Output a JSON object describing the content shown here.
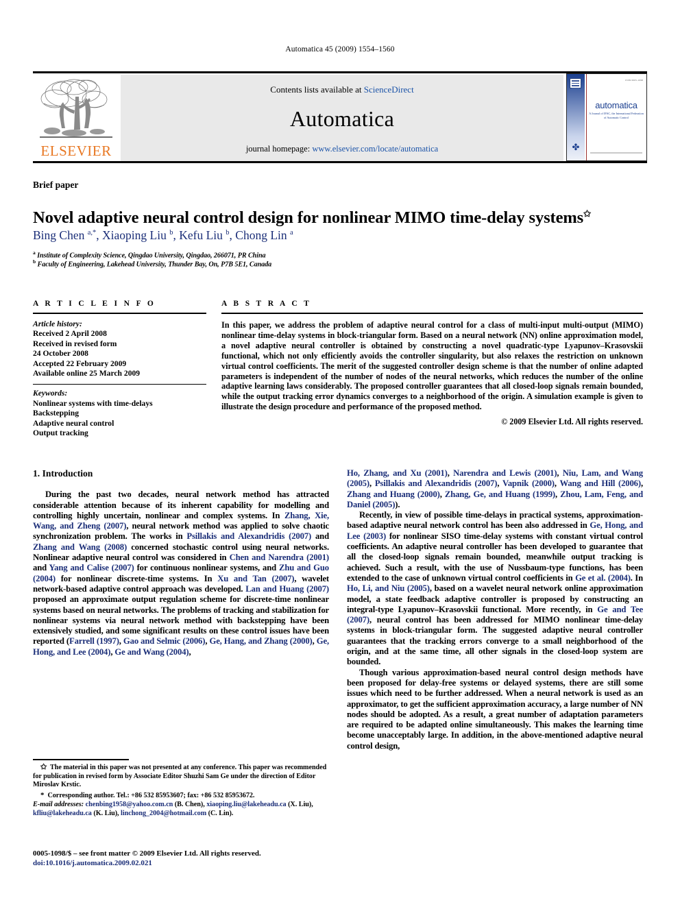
{
  "running_head": "Automatica 45 (2009) 1554–1560",
  "masthead": {
    "contents_prefix": "Contents lists available at ",
    "contents_link": "ScienceDirect",
    "journal_name": "Automatica",
    "homepage_prefix": "journal homepage: ",
    "homepage_link": "www.elsevier.com/locate/automatica",
    "publisher_wordmark": "ELSEVIER",
    "cover": {
      "title": "automatica",
      "subtitle": "A Journal of IFAC, the International Federation of Automatic Control",
      "corner_note": "ISSN 0005-1098"
    }
  },
  "article": {
    "type_label": "Brief paper",
    "title": "Novel adaptive neural control design for nonlinear MIMO time-delay systems",
    "title_star": "✩",
    "authors_html": "Bing Chen <sup>a,</sup><sup>*</sup>, Xiaoping Liu <sup>b</sup>, Kefu Liu <sup>b</sup>, Chong Lin <sup>a</sup>",
    "affiliation_a": "Institute of Complexity Science, Qingdao University, Qingdao, 266071, PR China",
    "affiliation_b": "Faculty of Engineering, Lakehead University, Thunder Bay, On, P7B 5E1, Canada"
  },
  "info": {
    "heading": "A R T I C L E    I N F O",
    "history_label": "Article history:",
    "history": [
      "Received 2 April 2008",
      "Received in revised form",
      "24 October 2008",
      "Accepted 22 February 2009",
      "Available online 25 March 2009"
    ],
    "keywords_label": "Keywords:",
    "keywords": [
      "Nonlinear systems with time-delays",
      "Backstepping",
      "Adaptive neural control",
      "Output tracking"
    ]
  },
  "abstract": {
    "heading": "A B S T R A C T",
    "text": "In this paper, we address the problem of adaptive neural control for a class of multi-input multi-output (MIMO) nonlinear time-delay systems in block-triangular form. Based on a neural network (NN) online approximation model, a novel adaptive neural controller is obtained by constructing a novel quadratic-type Lyapunov–Krasovskii functional, which not only efficiently avoids the controller singularity, but also relaxes the restriction on unknown virtual control coefficients. The merit of the suggested controller design scheme is that the number of online adapted parameters is independent of the number of nodes of the neural networks, which reduces the number of the online adaptive learning laws considerably. The proposed controller guarantees that all closed-loop signals remain bounded, while the output tracking error dynamics converges to a neighborhood of the origin. A simulation example is given to illustrate the design procedure and performance of the proposed method.",
    "copyright": "© 2009 Elsevier Ltd. All rights reserved."
  },
  "body": {
    "section1_heading": "1. Introduction",
    "left_paragraph_1_html": "During the past two decades, neural network method has attracted considerable attention because of its inherent capability for modelling and controlling highly uncertain, nonlinear and complex systems. In <span class=\"ref\">Zhang, Xie, Wang, and Zheng (2007)</span>, neural network method was applied to solve chaotic synchronization problem. The works in <span class=\"ref\">Psillakis and Alexandridis (2007)</span> and <span class=\"ref\">Zhang and Wang (2008)</span> concerned stochastic control using neural networks. Nonlinear adaptive neural control was considered in <span class=\"ref\">Chen and Narendra (2001)</span> and <span class=\"ref\">Yang and Calise (2007)</span> for continuous nonlinear systems, and <span class=\"ref\">Zhu and Guo (2004)</span> for nonlinear discrete-time systems. In <span class=\"ref\">Xu and Tan (2007)</span>, wavelet network-based adaptive control approach was developed. <span class=\"ref\">Lan and Huang (2007)</span> proposed an approximate output regulation scheme for discrete-time nonlinear systems based on neural networks. The problems of tracking and stabilization for nonlinear systems via neural network method with backstepping have been extensively studied, and some significant results on these control issues have been reported (<span class=\"ref\">Farrell (1997)</span>, <span class=\"ref\">Gao and Selmic (2006)</span>, <span class=\"ref\">Ge, Hang, and Zhang (2000)</span>, <span class=\"ref\">Ge, Hong, and Lee (2004)</span>, <span class=\"ref\">Ge and Wang (2004)</span>,",
    "right_paragraph_1_html": "<span class=\"ref\">Ho, Zhang, and Xu (2001)</span>, <span class=\"ref\">Narendra and Lewis (2001)</span>, <span class=\"ref\">Niu, Lam, and Wang (2005)</span>, <span class=\"ref\">Psillakis and Alexandridis (2007)</span>, <span class=\"ref\">Vapnik (2000)</span>, <span class=\"ref\">Wang and Hill (2006)</span>, <span class=\"ref\">Zhang and Huang (2000)</span>, <span class=\"ref\">Zhang, Ge, and Huang (1999)</span>, <span class=\"ref\">Zhou, Lam, Feng, and Daniel (2005)</span>).",
    "right_paragraph_2_html": "Recently, in view of possible time-delays in practical systems, approximation-based adaptive neural network control has been also addressed in <span class=\"ref\">Ge, Hong, and Lee (2003)</span> for nonlinear SISO time-delay systems with constant virtual control coefficients. An adaptive neural controller has been developed to guarantee that all the closed-loop signals remain bounded, meanwhile output tracking is achieved. Such a result, with the use of Nussbaum-type functions, has been extended to the case of unknown virtual control coefficients in <span class=\"ref\">Ge et al. (2004)</span>. In <span class=\"ref\">Ho, Li, and Niu (2005)</span>, based on a wavelet neural network online approximation model, a state feedback adaptive controller is proposed by constructing an integral-type Lyapunov–Krasovskii functional. More recently, in <span class=\"ref\">Ge and Tee (2007)</span>, neural control has been addressed for MIMO nonlinear time-delay systems in block-triangular form. The suggested adaptive neural controller guarantees that the tracking errors converge to a small neighborhood of the origin, and at the same time, all other signals in the closed-loop system are bounded.",
    "right_paragraph_3_html": "Though various approximation-based neural control design methods have been proposed for delay-free systems or delayed systems, there are still some issues which need to be further addressed. When a neural network is used as an approximator, to get the sufficient approximation accuracy, a large number of NN nodes should be adopted. As a result, a great number of adaptation parameters are required to be adapted online simultaneously. This makes the learning time become unacceptably large. In addition, in the above-mentioned adaptive neural control design,"
  },
  "footnotes": {
    "note_star_html": "<span class=\"star\">✩</span>&nbsp; The material in this paper was not presented at any conference. This paper was recommended for publication in revised form by Associate Editor Shuzhi Sam Ge under the direction of Editor Miroslav Krstic.",
    "corresponding_html": "<span class=\"star\">*</span>&nbsp; Corresponding author. Tel.: +86 532 85953607; fax: +86 532 85953672.",
    "emails_html": "<span class=\"fn-ital\">E-mail addresses:</span> <span class=\"fn-link\">chenbing1958@yahoo.com.cn</span> (B. Chen), <span class=\"fn-link\">xiaoping.liu@lakeheadu.ca</span> (X. Liu), <span class=\"fn-link\">kfliu@lakeheadu.ca</span> (K. Liu), <span class=\"fn-link\">linchong_2004@hotmail.com</span> (C. Lin)."
  },
  "imprint": {
    "line1": "0005-1098/$ – see front matter © 2009 Elsevier Ltd. All rights reserved.",
    "doi": "doi:10.1016/j.automatica.2009.02.021"
  }
}
